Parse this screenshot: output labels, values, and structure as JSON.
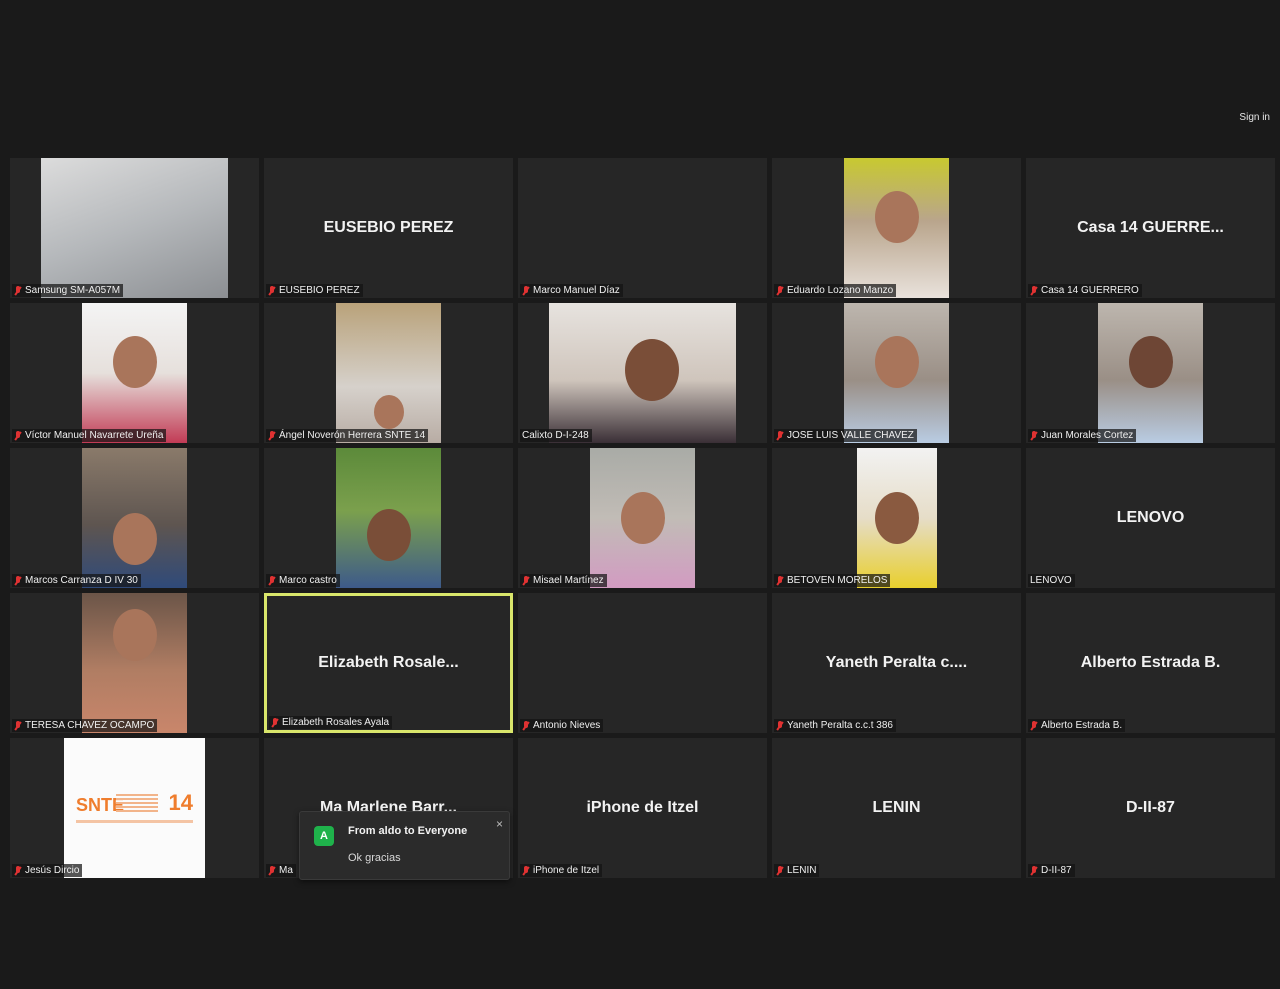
{
  "header": {
    "signin_label": "Sign in"
  },
  "tiles": [
    {
      "name": "Samsung SM-A057M"
    },
    {
      "name": "EUSEBIO PEREZ",
      "display": "EUSEBIO PEREZ"
    },
    {
      "name": "Marco Manuel Díaz"
    },
    {
      "name": "Eduardo Lozano Manzo"
    },
    {
      "name": "Casa 14 GUERRERO",
      "display": "Casa 14 GUERRE..."
    },
    {
      "name": "Víctor Manuel Navarrete Ureña"
    },
    {
      "name": "Ángel Noverón Herrera SNTE 14"
    },
    {
      "name": "Calixto D-I-248"
    },
    {
      "name": "JOSE LUIS VALLE CHAVEZ"
    },
    {
      "name": "Juan Morales Cortez"
    },
    {
      "name": "Marcos Carranza  D IV 30"
    },
    {
      "name": "Marco castro"
    },
    {
      "name": "Misael Martínez"
    },
    {
      "name": "BETOVEN MORELOS"
    },
    {
      "name": "LENOVO",
      "display": "LENOVO"
    },
    {
      "name": "TERESA CHAVEZ OCAMPO"
    },
    {
      "name": "Elizabeth Rosales Ayala",
      "display": "Elizabeth  Rosale..."
    },
    {
      "name": "Antonio Nieves"
    },
    {
      "name": "Yaneth Peralta c.c.t 386",
      "display": "Yaneth Peralta c...."
    },
    {
      "name": "Alberto Estrada B.",
      "display": "Alberto Estrada B."
    },
    {
      "name": "Jesús Dircio",
      "logo": {
        "brand": "SNTE",
        "number": "14"
      }
    },
    {
      "name": "Ma",
      "display": "Ma Marlene Barr..."
    },
    {
      "name": "iPhone de Itzel",
      "display": "iPhone de Itzel"
    },
    {
      "name": "LENIN",
      "display": "LENIN"
    },
    {
      "name": "D-II-87",
      "display": "D-II-87"
    }
  ],
  "chat_popup": {
    "avatar_letter": "A",
    "from": "From aldo  to Everyone",
    "message": "Ok gracias",
    "close_glyph": "×"
  },
  "colors": {
    "background": "#1a1a1a",
    "tile": "#262626",
    "active_speaker_border": "#d9e66b",
    "muted_icon": "#e03232",
    "chat_avatar": "#1fb24b"
  },
  "icons": {
    "muted": "muted-mic-icon",
    "close": "close-icon"
  }
}
